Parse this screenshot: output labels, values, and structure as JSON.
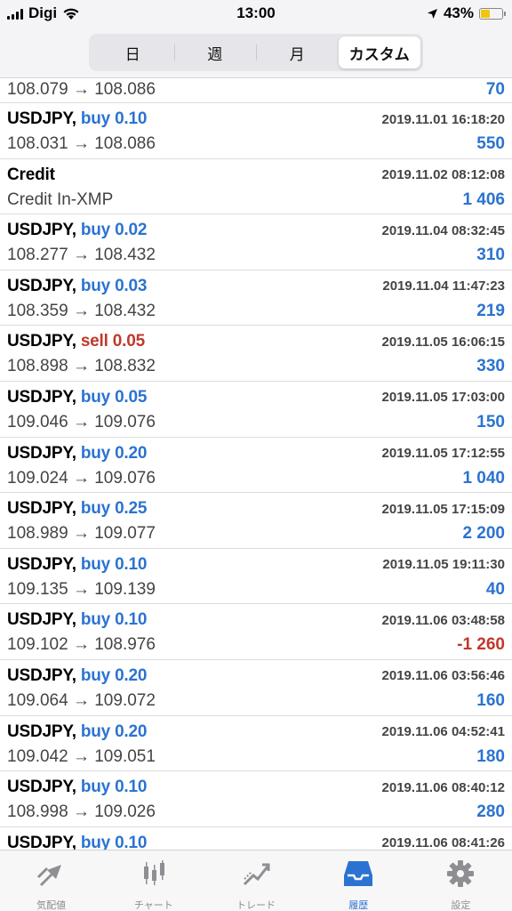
{
  "status_bar": {
    "carrier": "Digi",
    "time": "13:00",
    "battery": "43%",
    "battery_level": 0.43
  },
  "period_tabs": [
    {
      "label": "日",
      "active": false
    },
    {
      "label": "週",
      "active": false
    },
    {
      "label": "月",
      "active": false
    },
    {
      "label": "カスタム",
      "active": true
    }
  ],
  "history": {
    "partial_top": {
      "prices": "108.079 → 108.086",
      "profit": "70"
    },
    "rows": [
      {
        "symbol": "USDJPY,",
        "side": "buy 0.10",
        "type": "buy",
        "time": "2019.11.01 16:18:20",
        "prices": "108.031 → 108.086",
        "profit": "550",
        "neg": false
      },
      {
        "symbol": "Credit",
        "side": "",
        "type": "credit",
        "time": "2019.11.02 08:12:08",
        "prices": "Credit In-XMP",
        "profit": "1 406",
        "neg": false
      },
      {
        "symbol": "USDJPY,",
        "side": "buy 0.02",
        "type": "buy",
        "time": "2019.11.04 08:32:45",
        "prices": "108.277 → 108.432",
        "profit": "310",
        "neg": false
      },
      {
        "symbol": "USDJPY,",
        "side": "buy 0.03",
        "type": "buy",
        "time": "2019.11.04 11:47:23",
        "prices": "108.359 → 108.432",
        "profit": "219",
        "neg": false
      },
      {
        "symbol": "USDJPY,",
        "side": "sell 0.05",
        "type": "sell",
        "time": "2019.11.05 16:06:15",
        "prices": "108.898 → 108.832",
        "profit": "330",
        "neg": false
      },
      {
        "symbol": "USDJPY,",
        "side": "buy 0.05",
        "type": "buy",
        "time": "2019.11.05 17:03:00",
        "prices": "109.046 → 109.076",
        "profit": "150",
        "neg": false
      },
      {
        "symbol": "USDJPY,",
        "side": "buy 0.20",
        "type": "buy",
        "time": "2019.11.05 17:12:55",
        "prices": "109.024 → 109.076",
        "profit": "1 040",
        "neg": false
      },
      {
        "symbol": "USDJPY,",
        "side": "buy 0.25",
        "type": "buy",
        "time": "2019.11.05 17:15:09",
        "prices": "108.989 → 109.077",
        "profit": "2 200",
        "neg": false
      },
      {
        "symbol": "USDJPY,",
        "side": "buy 0.10",
        "type": "buy",
        "time": "2019.11.05 19:11:30",
        "prices": "109.135 → 109.139",
        "profit": "40",
        "neg": false
      },
      {
        "symbol": "USDJPY,",
        "side": "buy 0.10",
        "type": "buy",
        "time": "2019.11.06 03:48:58",
        "prices": "109.102 → 108.976",
        "profit": "-1 260",
        "neg": true
      },
      {
        "symbol": "USDJPY,",
        "side": "buy 0.20",
        "type": "buy",
        "time": "2019.11.06 03:56:46",
        "prices": "109.064 → 109.072",
        "profit": "160",
        "neg": false
      },
      {
        "symbol": "USDJPY,",
        "side": "buy 0.20",
        "type": "buy",
        "time": "2019.11.06 04:52:41",
        "prices": "109.042 → 109.051",
        "profit": "180",
        "neg": false
      },
      {
        "symbol": "USDJPY,",
        "side": "buy 0.10",
        "type": "buy",
        "time": "2019.11.06 08:40:12",
        "prices": "108.998 → 109.026",
        "profit": "280",
        "neg": false
      },
      {
        "symbol": "USDJPY,",
        "side": "buy 0.10",
        "type": "buy",
        "time": "2019.11.06 08:41:26",
        "prices": "",
        "profit": "",
        "neg": false
      }
    ]
  },
  "tabbar": [
    {
      "label": "気配値",
      "icon": "quotes-icon",
      "active": false
    },
    {
      "label": "チャート",
      "icon": "candlestick-chart-icon",
      "active": false
    },
    {
      "label": "トレード",
      "icon": "trade-icon",
      "active": false
    },
    {
      "label": "履歴",
      "icon": "history-inbox-icon",
      "active": true
    },
    {
      "label": "設定",
      "icon": "gear-icon",
      "active": false
    }
  ],
  "colors": {
    "buy": "#2b73d1",
    "sell": "#c0392b",
    "active_tab": "#2b73d1"
  }
}
